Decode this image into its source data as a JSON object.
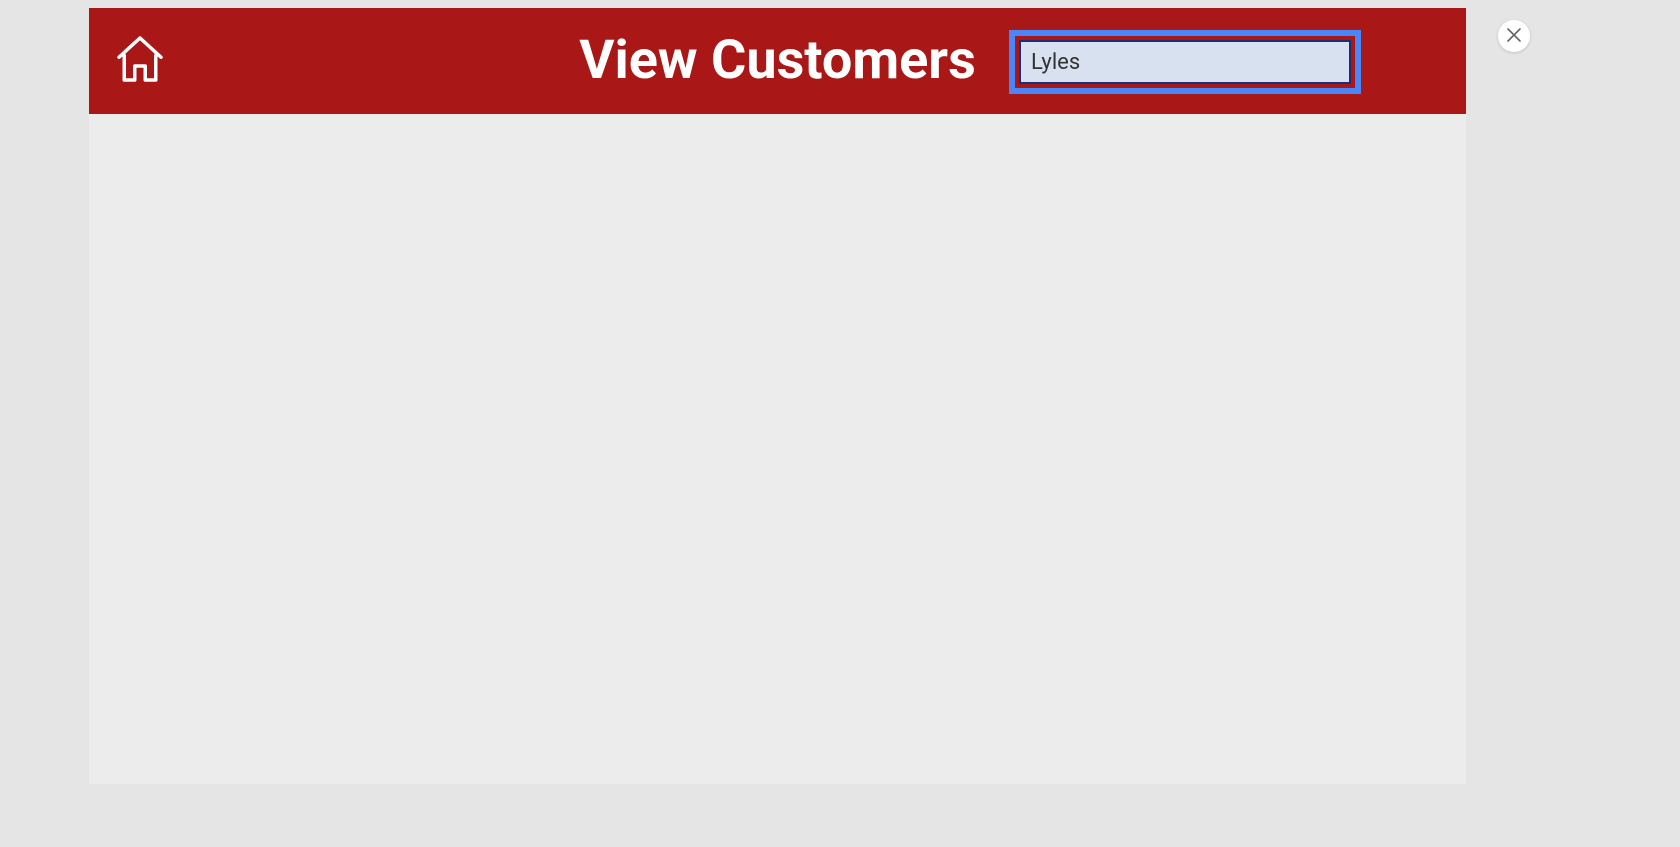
{
  "header": {
    "title": "View Customers",
    "search_value": "Lyles",
    "search_placeholder": ""
  }
}
